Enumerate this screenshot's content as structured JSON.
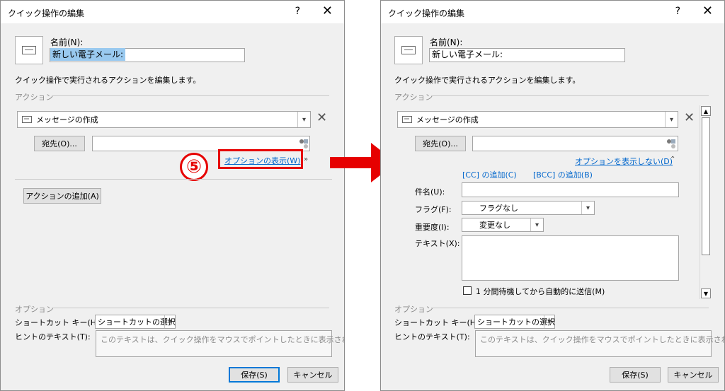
{
  "left_dialog": {
    "title": "クイック操作の編集",
    "help": "?",
    "close": "✕",
    "name_label": "名前(N):",
    "name_value": "新しい電子メール:",
    "description": "クイック操作で実行されるアクションを編集します。",
    "actions_section": "アクション",
    "action_combo": "メッセージの作成",
    "to_button": "宛先(O)...",
    "show_options_link": "オプションの表示(W)",
    "step_number": "⑤",
    "add_action_button": "アクションの追加(A)",
    "options_section": "オプション",
    "shortcut_label": "ショートカット キー(H):",
    "shortcut_value": "ショートカットの選択",
    "tooltip_label": "ヒントのテキスト(T):",
    "tooltip_placeholder": "このテキストは、クイック操作をマウスでポイントしたときに表示されます。",
    "save_button": "保存(S)",
    "cancel_button": "キャンセル"
  },
  "right_dialog": {
    "title": "クイック操作の編集",
    "help": "?",
    "close": "✕",
    "name_label": "名前(N):",
    "name_value": "新しい電子メール:",
    "description": "クイック操作で実行されるアクションを編集します。",
    "actions_section": "アクション",
    "action_combo": "メッセージの作成",
    "to_button": "宛先(O)...",
    "hide_options_link": "オプションを表示しない(D)",
    "add_cc_link": "[CC] の追加(C)",
    "add_bcc_link": "[BCC] の追加(B)",
    "subject_label": "件名(U):",
    "flag_label": "フラグ(F):",
    "flag_value": "フラグなし",
    "importance_label": "重要度(I):",
    "importance_value": "変更なし",
    "text_label": "テキスト(X):",
    "auto_send_label": "1 分間待機してから自動的に送信(M)",
    "options_section": "オプション",
    "shortcut_label": "ショートカット キー(H):",
    "shortcut_value": "ショートカットの選択",
    "tooltip_label": "ヒントのテキスト(T):",
    "tooltip_placeholder": "このテキストは、クイック操作をマウスでポイントしたときに表示されます。",
    "save_button": "保存(S)",
    "cancel_button": "キャンセル"
  },
  "colors": {
    "highlight_red": "#e60000",
    "link_blue": "#0066cc",
    "primary_border": "#0078d7"
  },
  "icons": {
    "mail": "envelope-icon",
    "remove": "close-x-icon",
    "address_book": "address-book-icon",
    "chevron": "chevron-down-icon",
    "arrow": "right-arrow-icon"
  }
}
